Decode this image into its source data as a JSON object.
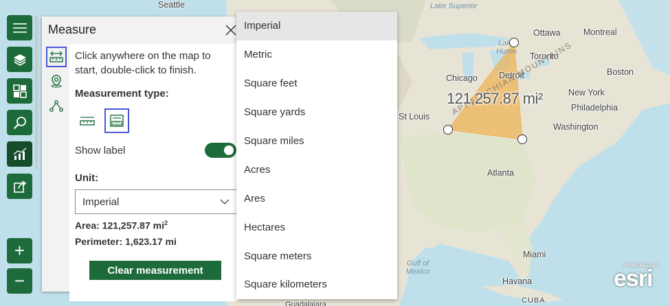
{
  "map": {
    "cities": [
      {
        "name": "Seattle"
      },
      {
        "name": "Ottawa"
      },
      {
        "name": "Montreal"
      },
      {
        "name": "Toronto"
      },
      {
        "name": "Boston"
      },
      {
        "name": "Chicago"
      },
      {
        "name": "Detroit"
      },
      {
        "name": "New York"
      },
      {
        "name": "Philadelphia"
      },
      {
        "name": "St Louis"
      },
      {
        "name": "Washington"
      },
      {
        "name": "Atlanta"
      },
      {
        "name": "Miami"
      },
      {
        "name": "Havana"
      },
      {
        "name": "CUBA"
      },
      {
        "name": "Guadalajara"
      }
    ],
    "waters": [
      "Lake Superior",
      "Gulf of Mexico",
      "Lake Huron"
    ],
    "regions": [
      "APPALACHIAN MOUNTAINS"
    ],
    "polygon_label": "121,257.87 mi²",
    "polygon_fill": "#f0b150",
    "attribution": {
      "powered": "POWERED BY",
      "logo": "esri"
    }
  },
  "toolbar": {
    "items": [
      {
        "name": "menu",
        "icon": "hamburger-icon"
      },
      {
        "name": "layers",
        "icon": "layers-icon"
      },
      {
        "name": "basemap",
        "icon": "basemap-gallery-icon"
      },
      {
        "name": "search",
        "icon": "search-icon"
      },
      {
        "name": "analysis",
        "icon": "chart-icon"
      },
      {
        "name": "share",
        "icon": "share-icon"
      }
    ],
    "zoom_in": "+",
    "zoom_out": "−",
    "accent": "#1d6b3b"
  },
  "panel": {
    "title": "Measure",
    "instructions": "Click anywhere on the map to start, double-click to finish.",
    "measurement_type_label": "Measurement type:",
    "show_label": "Show label",
    "show_label_on": true,
    "unit_label": "Unit:",
    "unit_value": "Imperial",
    "area_label": "Area: 121,257.87 mi",
    "area_sup": "2",
    "perimeter": "Perimeter: 1,623.17 mi",
    "clear_button": "Clear measurement"
  },
  "dropdown": {
    "options": [
      "Imperial",
      "Metric",
      "Square feet",
      "Square yards",
      "Square miles",
      "Acres",
      "Ares",
      "Hectares",
      "Square meters",
      "Square kilometers"
    ],
    "selected": "Imperial"
  }
}
